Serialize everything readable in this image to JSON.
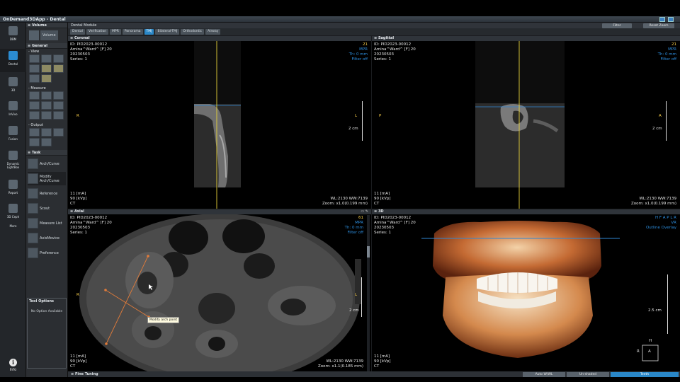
{
  "app": {
    "title": "OnDemand3DApp - Dental"
  },
  "rail": {
    "items": [
      {
        "label": "DBM",
        "icon": "database-icon"
      },
      {
        "label": "Dental",
        "icon": "tooth-icon"
      },
      {
        "label": "3D",
        "icon": "cube-3d-icon"
      },
      {
        "label": "InVivo",
        "icon": "invivo-icon"
      },
      {
        "label": "Fusion",
        "icon": "fusion-icon"
      },
      {
        "label": "Dynamic\nLightBox",
        "icon": "lightbox-icon"
      },
      {
        "label": "Report",
        "icon": "report-icon"
      },
      {
        "label": "3D Ceph",
        "icon": "ceph-icon"
      },
      {
        "label": "More",
        "icon": "more-icon"
      }
    ],
    "info_label": "Info"
  },
  "tools": {
    "volume_header": "Volume",
    "volume_button": "Volume",
    "general_header": "General",
    "view_label": "View",
    "measure_label": "Measure",
    "output_label": "Output",
    "task_header": "Task",
    "tasks": [
      "Arch/Curve",
      "Modify\nArch/Curve",
      "Reference",
      "Scout",
      "Measure List",
      "AxisMovice",
      "Preference"
    ],
    "tool_options_title": "Tool Options",
    "tool_options_text": "No Option Available"
  },
  "module": {
    "title": "Dental Module",
    "filter_button": "Filter",
    "reset_zoom_button": "Reset Zoom",
    "tabs": [
      "Dental",
      "Verification",
      "MPR",
      "Panorama",
      "TMJ",
      "Bilateral-TMJ",
      "Orthodontic",
      "Airway"
    ],
    "active_tab": "TMJ"
  },
  "views": {
    "coronal": {
      "title": "Coronal",
      "id": "ID: PID2023-00012",
      "name": "Amina^Ward^ [F] 20",
      "date": "20230503",
      "series": "Series: 1",
      "slice": "21",
      "mode": "MPR",
      "th": "Th: 0 mm",
      "filter": "Filter off",
      "left_orient": "R",
      "right_orient": "L",
      "scale": "2 cm",
      "ma": "11 [mA]",
      "kvp": "90 [kVp]",
      "modality": "CT",
      "wl": "WL:2130 WW:7139",
      "zoom": "Zoom: x1.0(0.199 mm)"
    },
    "sagittal": {
      "title": "Sagittal",
      "id": "ID: PID2023-00012",
      "name": "Amina^Ward^ [F] 20",
      "date": "20230503",
      "series": "Series: 1",
      "slice": "21",
      "mode": "MPR",
      "th": "Th: 0 mm",
      "filter": "Filter off",
      "left_orient": "P",
      "right_orient": "A",
      "scale": "2 cm",
      "ma": "11 [mA]",
      "kvp": "90 [kVp]",
      "modality": "CT",
      "wl": "WL:2130 WW:7139",
      "zoom": "Zoom: x1.0(0.199 mm)"
    },
    "axial": {
      "title": "Axial",
      "id": "ID: PID2023-00012",
      "name": "Amina^Ward^ [F] 20",
      "date": "20230503",
      "series": "Series: 1",
      "slice": "61",
      "mode": "MPR",
      "th": "Th: 0 mm",
      "filter": "Filter off",
      "left_orient": "R",
      "right_orient": "L",
      "scale": "2 cm",
      "ma": "11 [mA]",
      "kvp": "90 [kVp]",
      "modality": "CT",
      "wl": "WL:2130 WW:7139",
      "zoom": "Zoom: x1.1(0.185 mm)",
      "tooltip": "Modify arch point"
    },
    "three_d": {
      "title": "3D",
      "id": "ID: PID2023-00012",
      "name": "Amina^Ward^ [F] 20",
      "date": "20230503",
      "series": "Series: 1",
      "orientation_letters": "H F A P L R",
      "mode": "VR",
      "overlay": "Outline Overlay",
      "scale": "2.5 cm",
      "ma": "11 [mA]",
      "kvp": "90 [kVp]",
      "modality": "CT",
      "cube_top": "H",
      "cube_left": "R",
      "cube_center": "A"
    }
  },
  "status": {
    "title": "Fine Tuning",
    "auto_wwl": "Auto W/WL",
    "unshaded": "Un-shaded",
    "teeth": "Teeth"
  }
}
